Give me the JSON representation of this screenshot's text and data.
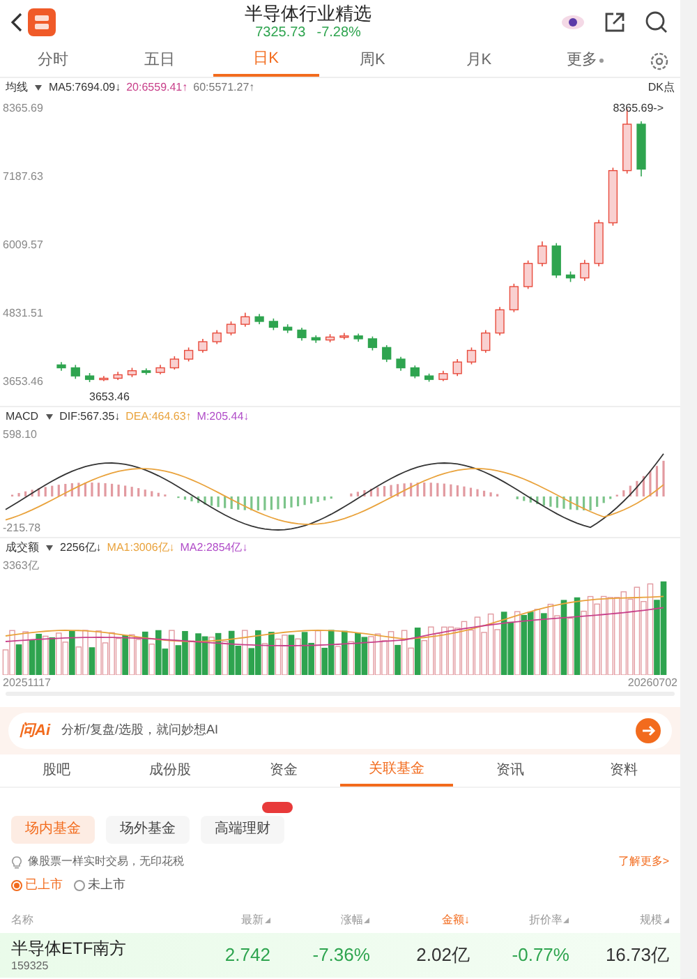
{
  "header": {
    "title": "半导体行业精选",
    "price": "7325.73",
    "change": "-7.28%"
  },
  "period_tabs": [
    {
      "label": "分时",
      "selected": false,
      "kind": "tab"
    },
    {
      "label": "五日",
      "selected": false,
      "kind": "tab"
    },
    {
      "label": "日K",
      "selected": true,
      "kind": "tab"
    },
    {
      "label": "周K",
      "selected": false,
      "kind": "tab"
    },
    {
      "label": "月K",
      "selected": false,
      "kind": "tab"
    },
    {
      "label": "更多",
      "selected": false,
      "kind": "dropdown"
    }
  ],
  "kline": {
    "legend_label": "均线",
    "legend": [
      "MA5:7694.09↓",
      "20:6559.41↑",
      "60:5571.27↑"
    ],
    "dk_label": "DK点",
    "high_marker": "8365.69->",
    "low_marker": "3653.46",
    "chart_data": {
      "type": "candlestick",
      "ylim": [
        3653.46,
        8365.69
      ],
      "yticks": [
        {
          "value": 8365.69,
          "label": "8365.69"
        },
        {
          "value": 7187.63,
          "label": "7187.63"
        },
        {
          "value": 6009.57,
          "label": "6009.57"
        },
        {
          "value": 4831.51,
          "label": "4831.51"
        },
        {
          "value": 3653.46,
          "label": "3653.46"
        }
      ],
      "categories": [
        null,
        null,
        null,
        null,
        null,
        null,
        null,
        null,
        null,
        null,
        null,
        null,
        null,
        null,
        null,
        null,
        null,
        null,
        null,
        null,
        null,
        null,
        null,
        null,
        null,
        null,
        null,
        null,
        null,
        null,
        null,
        null,
        null,
        null,
        null,
        null,
        null,
        null,
        null,
        null,
        null,
        null
      ],
      "ohlc": [
        [
          3950,
          4000,
          3850,
          3900
        ],
        [
          3900,
          3950,
          3710,
          3760
        ],
        [
          3760,
          3810,
          3653.46,
          3700
        ],
        [
          3700,
          3760,
          3670,
          3720
        ],
        [
          3720,
          3830,
          3690,
          3780
        ],
        [
          3780,
          3900,
          3740,
          3850
        ],
        [
          3850,
          3890,
          3780,
          3820
        ],
        [
          3820,
          3950,
          3790,
          3900
        ],
        [
          3900,
          4100,
          3870,
          4050
        ],
        [
          4050,
          4250,
          4010,
          4200
        ],
        [
          4200,
          4400,
          4160,
          4350
        ],
        [
          4350,
          4550,
          4310,
          4500
        ],
        [
          4500,
          4700,
          4460,
          4650
        ],
        [
          4650,
          4850,
          4610,
          4780
        ],
        [
          4780,
          4830,
          4650,
          4700
        ],
        [
          4700,
          4750,
          4550,
          4600
        ],
        [
          4600,
          4650,
          4500,
          4550
        ],
        [
          4550,
          4590,
          4370,
          4420
        ],
        [
          4420,
          4460,
          4330,
          4380
        ],
        [
          4380,
          4480,
          4340,
          4430
        ],
        [
          4430,
          4500,
          4390,
          4450
        ],
        [
          4450,
          4490,
          4350,
          4400
        ],
        [
          4400,
          4440,
          4200,
          4250
        ],
        [
          4250,
          4290,
          4000,
          4050
        ],
        [
          4050,
          4090,
          3850,
          3900
        ],
        [
          3900,
          3940,
          3720,
          3760
        ],
        [
          3760,
          3800,
          3660,
          3700
        ],
        [
          3700,
          3850,
          3670,
          3800
        ],
        [
          3800,
          4050,
          3760,
          4000
        ],
        [
          4000,
          4250,
          3960,
          4200
        ],
        [
          4200,
          4550,
          4160,
          4500
        ],
        [
          4500,
          4950,
          4460,
          4900
        ],
        [
          4900,
          5350,
          4860,
          5300
        ],
        [
          5300,
          5750,
          5260,
          5700
        ],
        [
          5700,
          6080,
          5650,
          6000
        ],
        [
          6000,
          6050,
          5450,
          5500
        ],
        [
          5500,
          5560,
          5380,
          5450
        ],
        [
          5450,
          5760,
          5400,
          5700
        ],
        [
          5700,
          6450,
          5650,
          6400
        ],
        [
          6400,
          7350,
          6350,
          7300
        ],
        [
          7300,
          8365.69,
          7250,
          8100
        ],
        [
          8100,
          8150,
          7200,
          7325.73
        ]
      ]
    }
  },
  "macd": {
    "label": "MACD",
    "legend": [
      "DIF:567.35↓",
      "DEA:464.63↑",
      "M:205.44↓"
    ],
    "y_labels": [
      "598.10",
      "-215.78"
    ]
  },
  "volume": {
    "label": "成交额",
    "legend": [
      "2256亿↓",
      "MA1:3006亿↓",
      "MA2:2854亿↓"
    ],
    "y_label": "3363亿"
  },
  "dates": [
    "20251117",
    "20260702"
  ],
  "ai_bar": {
    "logo": "问Ai",
    "placeholder": "分析/复盘/选股，就问妙想AI"
  },
  "section_tabs": [
    {
      "label": "股吧",
      "selected": false
    },
    {
      "label": "成份股",
      "selected": false
    },
    {
      "label": "资金",
      "selected": false
    },
    {
      "label": "关联基金",
      "selected": true
    },
    {
      "label": "资讯",
      "selected": false
    },
    {
      "label": "资料",
      "selected": false
    }
  ],
  "fund_tabs": [
    {
      "label": "场内基金",
      "selected": true,
      "badge": false
    },
    {
      "label": "场外基金",
      "selected": false,
      "badge": false
    },
    {
      "label": "高端理财",
      "selected": false,
      "badge": true
    }
  ],
  "tip": {
    "text": "像股票一样实时交易，无印花税",
    "link": "了解更多>"
  },
  "listing_filter": [
    {
      "label": "已上市",
      "selected": true
    },
    {
      "label": "未上市",
      "selected": false
    }
  ],
  "table": {
    "columns": [
      {
        "label": "名称",
        "kind": "plain"
      },
      {
        "label": "最新",
        "kind": "sortable"
      },
      {
        "label": "涨幅",
        "kind": "sortable"
      },
      {
        "label": "金额↓",
        "kind": "sorted"
      },
      {
        "label": "折价率",
        "kind": "sortable"
      },
      {
        "label": "规模",
        "kind": "sortable"
      }
    ],
    "rows": [
      {
        "name": "半导体ETF南方",
        "code": "159325",
        "latest": "2.742",
        "change": "-7.36%",
        "amount": "2.02亿",
        "discount": "-0.77%",
        "scale": "16.73亿"
      }
    ]
  }
}
